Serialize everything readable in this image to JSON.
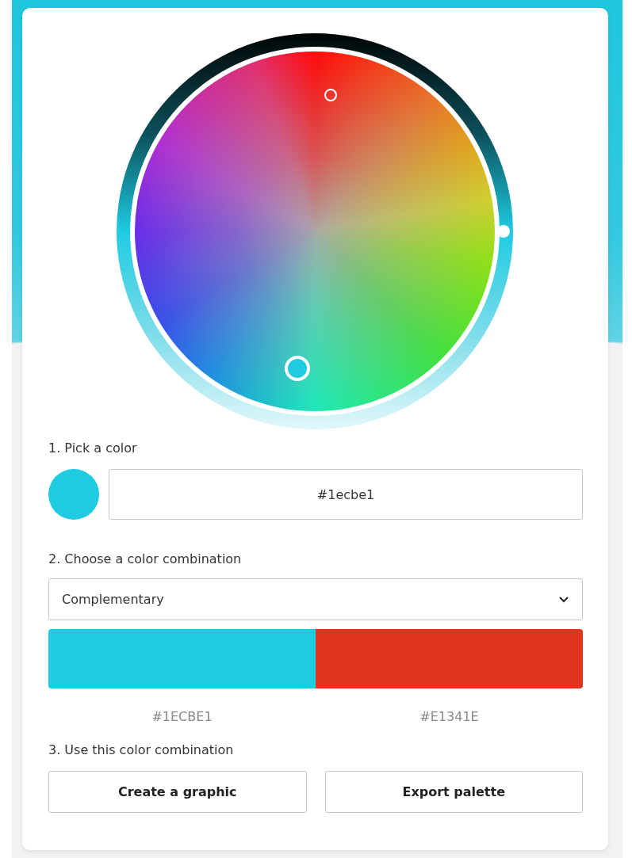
{
  "step1": {
    "label": "1. Pick a color",
    "color": "#1ecbe1",
    "value": "#1ecbe1"
  },
  "step2": {
    "label": "2. Choose a color combination",
    "combination": "Complementary",
    "swatches": [
      {
        "color": "#1ecbe1",
        "label": "#1ECBE1"
      },
      {
        "color": "#e1341e",
        "label": "#E1341E"
      }
    ]
  },
  "step3": {
    "label": "3. Use this color combination",
    "buttons": [
      "Create a graphic",
      "Export palette"
    ]
  }
}
